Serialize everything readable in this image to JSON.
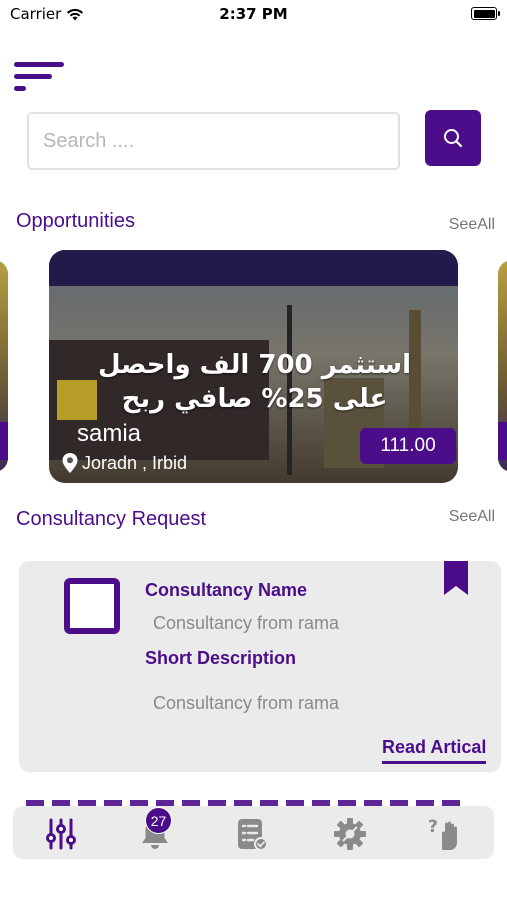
{
  "status_bar": {
    "carrier": "Carrier",
    "time": "2:37 PM"
  },
  "search": {
    "placeholder": "Search ...."
  },
  "opportunities": {
    "title": "Opportunities",
    "see_all": "SeeAll",
    "card": {
      "headline": "استثمر 700 الف واحصل على 25% صافي ربح",
      "name": "samia",
      "price": "111.00",
      "location": "Joradn ,  Irbid"
    }
  },
  "consultancy": {
    "title": "Consultancy Request",
    "see_all": "SeeAll",
    "card": {
      "name_label": "Consultancy Name",
      "name_value": "Consultancy from rama",
      "desc_label": "Short Description",
      "desc_value": "Consultancy from rama",
      "read_label": "Read Artical"
    }
  },
  "tabs": {
    "notification_count": "27",
    "items": [
      "sliders-icon",
      "bell-icon",
      "document-check-icon",
      "settings-gear-icon",
      "help-hand-icon"
    ]
  },
  "colors": {
    "accent": "#4b0d8a",
    "card_bg": "#ebebeb",
    "muted_text": "#8a8a8a"
  }
}
